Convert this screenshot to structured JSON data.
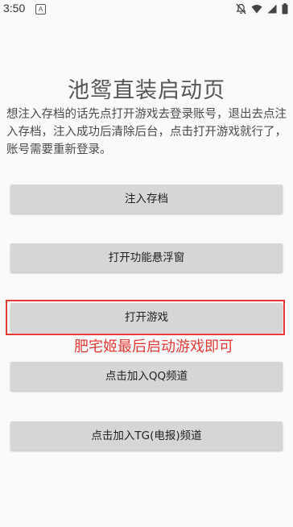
{
  "status_bar": {
    "time": "3:50",
    "app_icon_letter": "A"
  },
  "page": {
    "title": "池鸳直装启动页",
    "intro": "想注入存档的话先点打开游戏去登录账号，退出去点注入存档，注入成功后清除后台，点击打开游戏就行了，账号需要重新登录。"
  },
  "buttons": {
    "inject_save": "注入存档",
    "open_float_window": "打开功能悬浮窗",
    "open_game": "打开游戏",
    "join_qq": "点击加入QQ频道",
    "join_tg": "点击加入TG(电报)频道"
  },
  "annotation": {
    "text": "肥宅姬最后启动游戏即可",
    "color": "#e53935"
  }
}
